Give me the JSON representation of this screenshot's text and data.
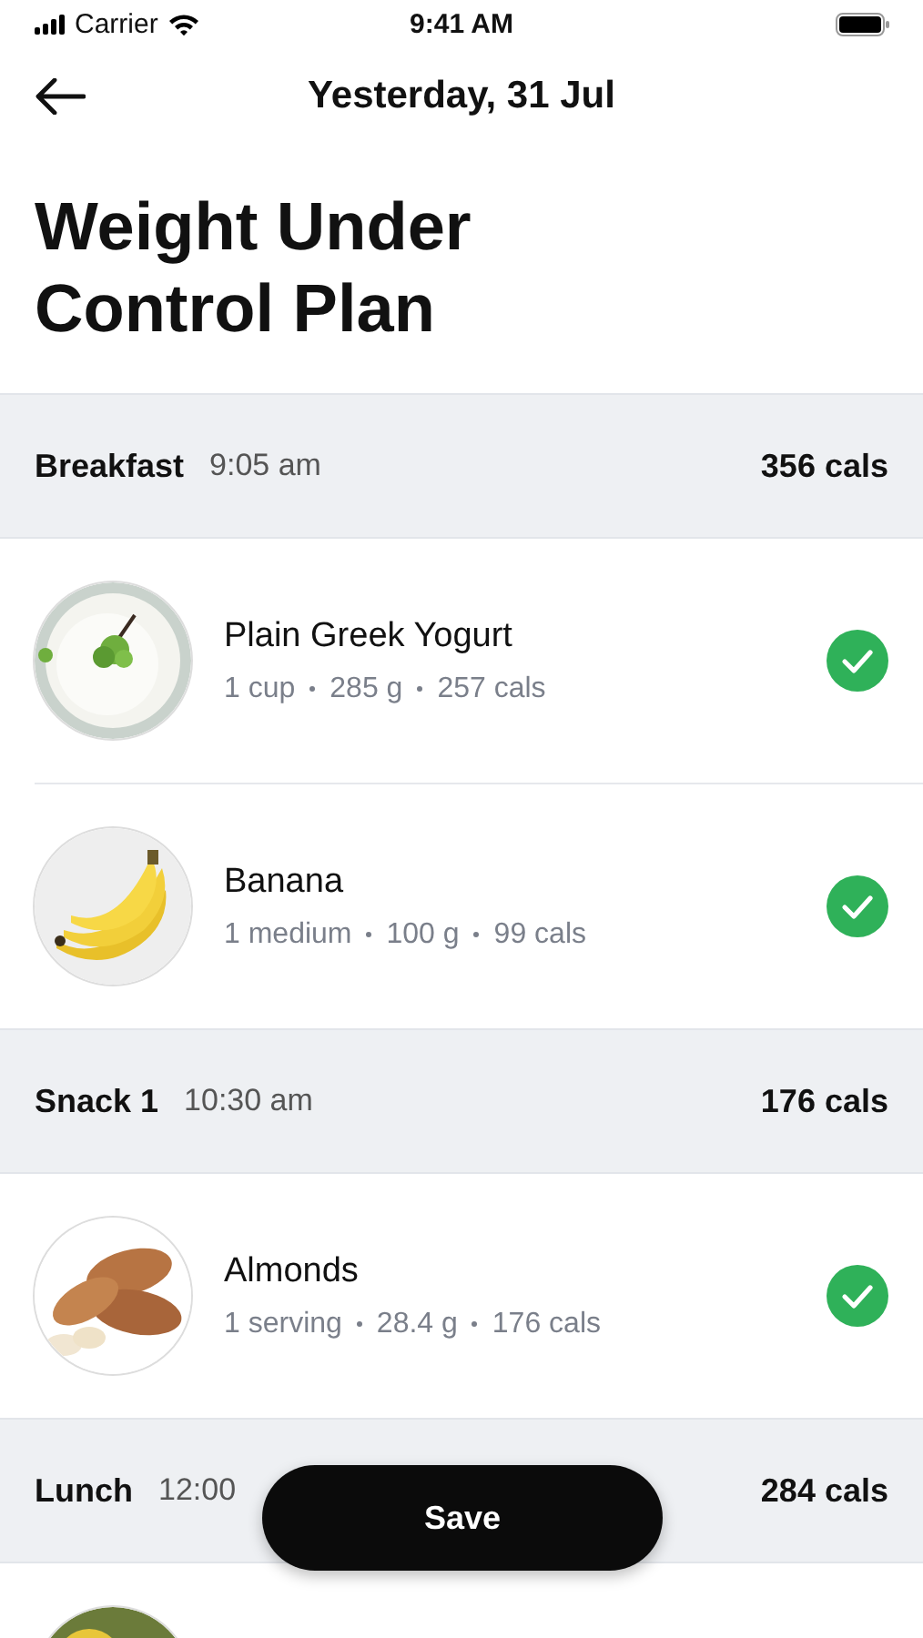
{
  "status_bar": {
    "carrier": "Carrier",
    "time": "9:41 AM"
  },
  "header": {
    "title": "Yesterday, 31 Jul"
  },
  "plan_title": "Weight Under Control Plan",
  "meals": [
    {
      "name": "Breakfast",
      "time": "9:05 am",
      "calories": "356 cals",
      "items": [
        {
          "kind": "picture",
          "name": "Plain Greek Yogurt",
          "details": [
            "1 cup",
            "285 g",
            "257 cals"
          ],
          "done": true
        },
        {
          "kind": "picture",
          "name": "Banana",
          "details": [
            "1 medium",
            "100 g",
            "99 cals"
          ],
          "done": true
        }
      ]
    },
    {
      "name": "Snack 1",
      "time": "10:30 am",
      "calories": "176 cals",
      "items": [
        {
          "kind": "picture",
          "name": "Almonds",
          "details": [
            "1 serving",
            "28.4 g",
            "176 cals"
          ],
          "done": true
        }
      ]
    },
    {
      "name": "Lunch",
      "time": "12:00",
      "calories": "284 cals"
    }
  ],
  "save_button": "Save"
}
